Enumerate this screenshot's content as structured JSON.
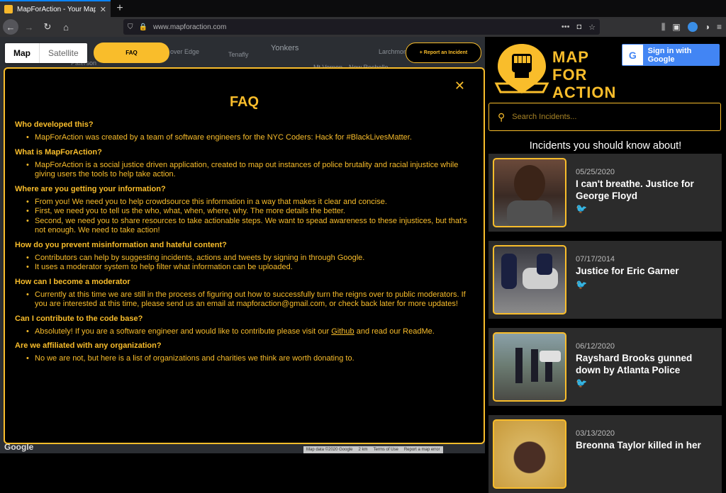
{
  "browser": {
    "tab_title": "MapForAction - Your Map For C",
    "url": "www.mapforaction.com"
  },
  "map": {
    "toggle_map": "Map",
    "toggle_satellite": "Satellite",
    "faq_button": "FAQ",
    "report_button": "+ Report an Incident",
    "labels": [
      "Yonkers",
      "Tenafly",
      "Larchmont",
      "Mt Vernon",
      "New Rochelle",
      "over Edge",
      "Paterson"
    ],
    "google": "Google",
    "attribution": [
      "Map data ©2020 Google",
      "2 km",
      "Terms of Use",
      "Report a map error"
    ]
  },
  "faq": {
    "title": "FAQ",
    "close": "✕",
    "items": [
      {
        "q": "Who developed this?",
        "a": [
          "MapForAction was created by a team of software engineers for the NYC Coders: Hack for #BlackLivesMatter."
        ]
      },
      {
        "q": "What is MapForAction?",
        "a": [
          "MapForAction is a social justice driven application, created to map out instances of police brutality and racial injustice while giving users the tools to help take action."
        ]
      },
      {
        "q": "Where are you getting your information?",
        "a": [
          "From you! We need you to help crowdsource this information in a way that makes it clear and concise.",
          "First, we need you to tell us the who, what, when, where, why. The more details the better.",
          "Second, we need you to share resources to take actionable steps. We want to spead awareness to these injustices, but that's not enough. We need to take action!"
        ]
      },
      {
        "q": "How do you prevent misinformation and hateful content?",
        "a": [
          "Contributors can help by suggesting incidents, actions and tweets by signing in through Google.",
          "It uses a moderator system to help filter what information can be uploaded."
        ]
      },
      {
        "q": "How can I become a moderator",
        "a": [
          "Currently at this time we are still in the process of figuring out how to successfully turn the reigns over to public moderators. If you are interested at this time, please send us an email at mapforaction@gmail.com, or check back later for more updates!"
        ]
      },
      {
        "q": "Can I contribute to the code base?",
        "a_parts": [
          "Absolutely! If you are a software engineer and would like to contribute please visit our ",
          "Github",
          " and read our ReadMe."
        ]
      },
      {
        "q": "Are we affiliated with any organization?",
        "a": [
          "No we are not, but here is a list of organizations and charities we think are worth donating to."
        ]
      }
    ]
  },
  "panel": {
    "logo_line1": "MAP",
    "logo_line2": "FOR",
    "logo_line3": "ACTION",
    "google_signin": "Sign in with Google",
    "search_placeholder": "Search Incidents...",
    "heading": "Incidents you should know about!",
    "incidents": [
      {
        "date": "05/25/2020",
        "title": "I can't breathe. Justice for George Floyd"
      },
      {
        "date": "07/17/2014",
        "title": "Justice for Eric Garner"
      },
      {
        "date": "06/12/2020",
        "title": "Rayshard Brooks gunned down by Atlanta Police"
      },
      {
        "date": "03/13/2020",
        "title": "Breonna Taylor killed in her"
      }
    ]
  },
  "colors": {
    "accent": "#f9bd2b",
    "panel_bg": "#000000",
    "card_bg": "#2b2b2b"
  }
}
